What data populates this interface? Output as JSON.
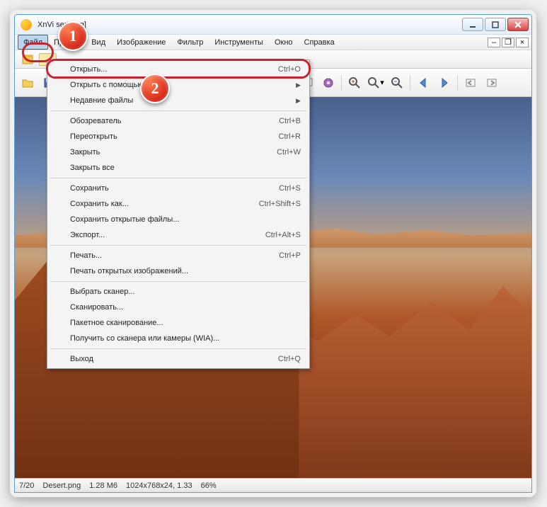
{
  "window": {
    "title": "XnVi        sert.png]"
  },
  "menubar": {
    "items": [
      "Файл",
      "Правка",
      "Вид",
      "Изображение",
      "Фильтр",
      "Инструменты",
      "Окно",
      "Справка"
    ]
  },
  "dropdown": {
    "items": [
      {
        "label": "Открыть...",
        "shortcut": "Ctrl+O",
        "highlight": true
      },
      {
        "label": "Открыть с помощью",
        "submenu": true
      },
      {
        "label": "Недавние файлы",
        "submenu": true
      },
      {
        "sep": true
      },
      {
        "label": "Обозреватель",
        "shortcut": "Ctrl+B"
      },
      {
        "label": "Переоткрыть",
        "shortcut": "Ctrl+R"
      },
      {
        "label": "Закрыть",
        "shortcut": "Ctrl+W"
      },
      {
        "label": "Закрыть все"
      },
      {
        "sep": true
      },
      {
        "label": "Сохранить",
        "shortcut": "Ctrl+S"
      },
      {
        "label": "Сохранить как...",
        "shortcut": "Ctrl+Shift+S"
      },
      {
        "label": "Сохранить открытые файлы..."
      },
      {
        "label": "Экспорт...",
        "shortcut": "Ctrl+Alt+S"
      },
      {
        "sep": true
      },
      {
        "label": "Печать...",
        "shortcut": "Ctrl+P"
      },
      {
        "label": "Печать открытых изображений..."
      },
      {
        "sep": true
      },
      {
        "label": "Выбрать сканер..."
      },
      {
        "label": "Сканировать..."
      },
      {
        "label": "Пакетное сканирование..."
      },
      {
        "label": "Получить со сканера или камеры (WIA)..."
      },
      {
        "sep": true
      },
      {
        "label": "Выход",
        "shortcut": "Ctrl+Q"
      }
    ]
  },
  "status": {
    "index": "7/20",
    "filename": "Desert.png",
    "size": "1.28 М6",
    "dims": "1024x768x24, 1.33",
    "zoom": "66%"
  },
  "badges": {
    "one": "1",
    "two": "2"
  }
}
